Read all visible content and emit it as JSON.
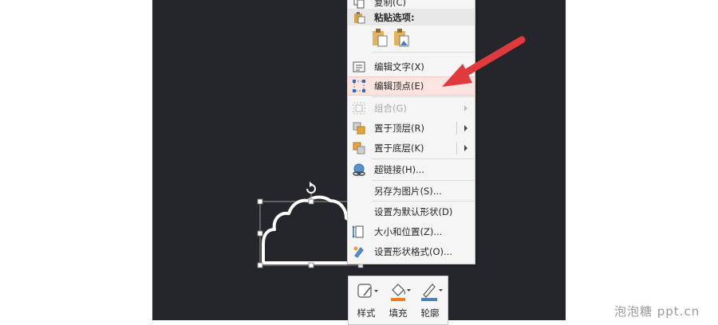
{
  "context_menu": {
    "items": [
      {
        "label": "复制(C)",
        "state": "normal"
      },
      {
        "label": "粘贴选项:",
        "state": "section"
      },
      {
        "label": "编辑文字(X)",
        "state": "normal"
      },
      {
        "label": "编辑顶点(E)",
        "state": "highlighted"
      },
      {
        "label": "组合(G)",
        "state": "disabled",
        "submenu": true
      },
      {
        "label": "置于顶层(R)",
        "state": "normal",
        "submenu": true
      },
      {
        "label": "置于底层(K)",
        "state": "normal",
        "submenu": true
      },
      {
        "label": "超链接(H)...",
        "state": "normal"
      },
      {
        "label": "另存为图片(S)...",
        "state": "normal"
      },
      {
        "label": "设置为默认形状(D)",
        "state": "normal"
      },
      {
        "label": "大小和位置(Z)...",
        "state": "normal"
      },
      {
        "label": "设置形状格式(O)...",
        "state": "normal"
      }
    ],
    "paste_options": [
      "keep-source-formatting-icon",
      "paste-as-picture-icon"
    ]
  },
  "mini_toolbar": {
    "style_label": "样式",
    "fill_label": "填充",
    "outline_label": "轮廓",
    "fill_color": "#f07a1e",
    "outline_color": "#4a7fc1"
  },
  "colors": {
    "canvas_bg": "#24262b",
    "highlight_bg": "#fce4e1",
    "annotation_arrow": "#e0393e",
    "shape_stroke": "#ffffff"
  },
  "watermark": "泡泡糖 ppt.cn"
}
